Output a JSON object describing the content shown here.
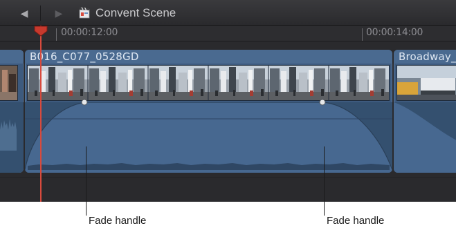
{
  "toolbar": {
    "back_icon": "back-arrow-icon",
    "forward_icon": "forward-arrow-icon",
    "project_icon": "clapperboard-icon",
    "project_title": "Convent Scene"
  },
  "ruler": {
    "labels": [
      "00:00:12:00",
      "00:00:14:00"
    ]
  },
  "clips": [
    {
      "name": ""
    },
    {
      "name": "B016_C077_0528GD"
    },
    {
      "name": "Broadway_"
    }
  ],
  "callouts": [
    {
      "label": "Fade handle"
    },
    {
      "label": "Fade handle"
    }
  ],
  "colors": {
    "playhead": "#d84a3d",
    "clip_body": "#3d5a7e",
    "clip_header": "#4a6a90"
  }
}
